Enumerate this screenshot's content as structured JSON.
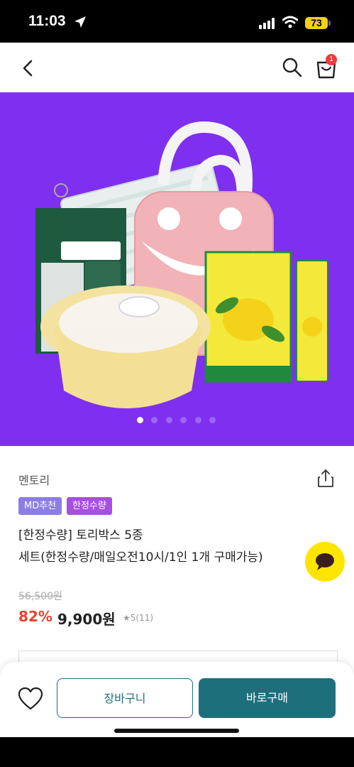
{
  "status_bar": {
    "time": "11:03",
    "battery": "73"
  },
  "header": {
    "cart_count": "1"
  },
  "hero": {
    "slide_count": 6,
    "active_slide": 1
  },
  "product": {
    "brand": "멘토리",
    "tags": [
      "MD추천",
      "한정수량"
    ],
    "title_line1": "[한정수량] 토리박스 5종",
    "title_line2": "세트(한정수량/매일오전10시/1인 1개 구매가능)",
    "original_price": "56,500원",
    "discount": "82%",
    "price": "9,900원",
    "rating": "★5(11)"
  },
  "actions": {
    "cart_label": "장바구니",
    "buy_label": "바로구매"
  },
  "colors": {
    "hero_bg": "#7f2ff0",
    "primary": "#1d6f7c",
    "discount": "#e8432e",
    "kakao": "#fee500",
    "tag_md": "#8b7ee6",
    "tag_limited": "#a74fe0"
  }
}
